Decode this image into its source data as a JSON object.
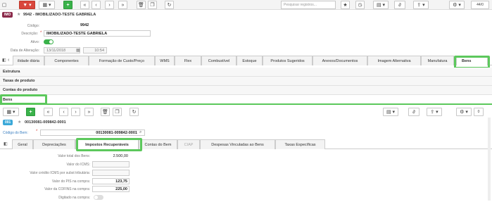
{
  "toolbar": {
    "search_placeholder": "Pesquisar registros...",
    "page_counter": "44/0"
  },
  "record": {
    "module_badge": "IMO",
    "title": "9942 - IMOBILIZADO-TESTE GABRIELA",
    "codigo_label": "Código:",
    "codigo_value": "9942",
    "descricao_label": "Descrição:",
    "descricao_value": "IMOBILIZADO-TESTE GABRIELA",
    "ativo_label": "Ativo:",
    "ativo_value": true,
    "data_label": "Data de Alteração:",
    "data_value": "13/11/2018",
    "hora_value": "10:54"
  },
  "tabs_top": [
    "ilidade diária",
    "Componentes",
    "Formação de Custo/Preço",
    "WMS",
    "Flex",
    "Combustível",
    "Estoque",
    "Produtos Sugeridos",
    "Anexos/Documentos",
    "Imagem Alternativa",
    "Manufatura",
    "Bens"
  ],
  "sections": [
    "Estrutura",
    "Taxas de produto",
    "Contas do produto",
    "Bens"
  ],
  "sub": {
    "badge": "001",
    "title": "00130081-009842-0001",
    "codigo_bem_label": "Código do Bem:",
    "codigo_bem_value": "00130081-009842-0001",
    "page_counter": "0"
  },
  "tabs_bottom": [
    "Geral",
    "Depreciações",
    "Impostos Recuperáveis",
    "Contas do Bem",
    "CIAP",
    "Despesas Vinculadas ao Bens",
    "Taxas Específicas"
  ],
  "fields": [
    {
      "label": "Valor total dos Bens:",
      "value": "2.500,00"
    },
    {
      "label": "Valor do ICMS:",
      "value": ""
    },
    {
      "label": "Valor crédito ICMS por subst tributária:",
      "value": ""
    },
    {
      "label": "Valor do PIS na compra:",
      "value": "123,75"
    },
    {
      "label": "Valor da COFINS na compra:",
      "value": "225,00"
    },
    {
      "label": "Digitado na compra:",
      "value": ""
    }
  ]
}
